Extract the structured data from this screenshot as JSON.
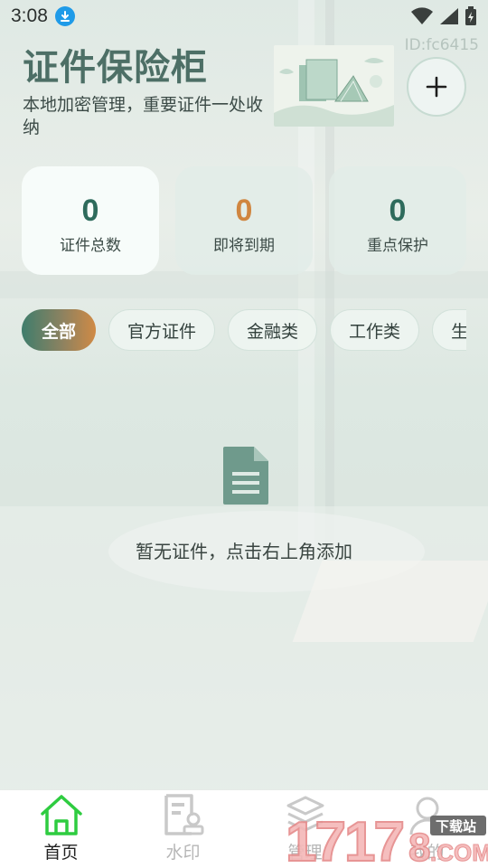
{
  "status_bar": {
    "time": "3:08"
  },
  "header": {
    "title": "证件保险柜",
    "subtitle": "本地加密管理，重要证件一处收纳",
    "user_id": "ID:fc6415"
  },
  "stats": [
    {
      "value": "0",
      "label": "证件总数",
      "color": "#2e6b5c"
    },
    {
      "value": "0",
      "label": "即将到期",
      "color": "#d08640"
    },
    {
      "value": "0",
      "label": "重点保护",
      "color": "#2e6b5c"
    }
  ],
  "categories": [
    "全部",
    "官方证件",
    "金融类",
    "工作类",
    "生"
  ],
  "empty_state": {
    "icon": "document-icon",
    "text": "暂无证件，点击右上角添加"
  },
  "bottom_nav": [
    {
      "label": "首页",
      "icon": "home-icon",
      "active": true
    },
    {
      "label": "水印",
      "icon": "watermark-icon",
      "active": false
    },
    {
      "label": "管理",
      "icon": "layers-icon",
      "active": false
    },
    {
      "label": "我的",
      "icon": "user-icon",
      "active": false
    }
  ],
  "watermark": {
    "brand": "1717",
    "tag": "下载站",
    "suffix": ".COM"
  },
  "colors": {
    "accent": "#4d6f66",
    "nav_active": "#2ecc40",
    "warning": "#d08640"
  }
}
